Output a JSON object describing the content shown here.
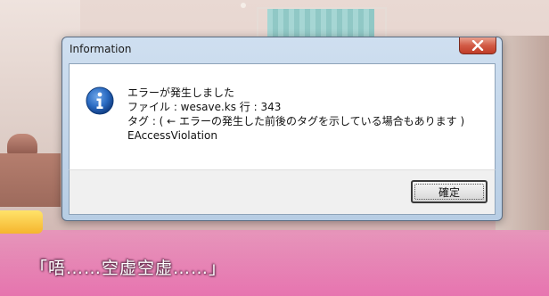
{
  "dialog": {
    "title": "Information",
    "icon": "info-icon",
    "message_lines": [
      "エラーが発生しました",
      "ファイル : wesave.ks   行 : 343",
      "タグ : ( ← エラーの発生した前後のタグを示している場合もあります )",
      "EAccessViolation"
    ],
    "ok_label": "確定",
    "close_icon": "close-icon"
  },
  "background": {
    "dialogue": "「唔……空虚空虚……」"
  },
  "colors": {
    "close_button": "#c03c28",
    "dialogue_band": "#e870af",
    "info_icon": "#1e5fb0"
  }
}
